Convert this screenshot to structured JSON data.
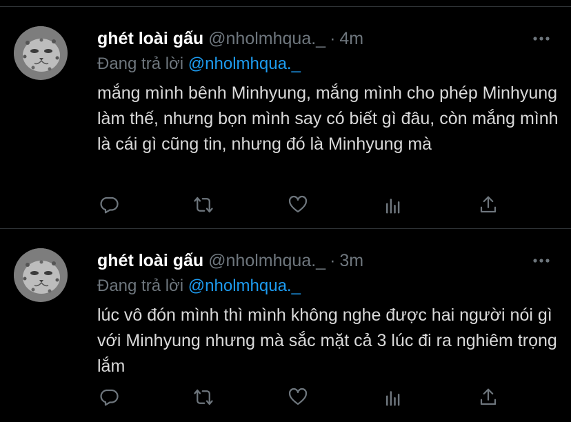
{
  "tweets": [
    {
      "author_name": "ghét loài gấu",
      "handle": "@nholmhqua._",
      "separator": "·",
      "time": "4m",
      "replying_prefix": "Đang trả lời",
      "replying_mention": "@nholmhqua._",
      "text": "mắng mình bênh Minhyung, mắng mình cho phép Minhyung làm thế, nhưng bọn mình say có biết gì đâu, còn mắng mình là cái gì cũng tin, nhưng đó là Minhyung mà"
    },
    {
      "author_name": "ghét loài gấu",
      "handle": "@nholmhqua._",
      "separator": "·",
      "time": "3m",
      "replying_prefix": "Đang trả lời",
      "replying_mention": "@nholmhqua._",
      "text": "lúc vô đón mình thì mình không nghe được hai người nói gì với Minhyung nhưng mà sắc mặt cả 3 lúc đi ra nghiêm trọng lắm"
    }
  ],
  "icons": {
    "more": "more-options-icon",
    "reply": "reply-icon",
    "retweet": "retweet-icon",
    "like": "heart-icon",
    "stats": "stats-icon",
    "share": "share-icon"
  },
  "colors": {
    "background": "#000000",
    "name": "#ffffff",
    "text": "#d9d9d9",
    "muted": "#6e767d",
    "mention": "#1d9bf0",
    "divider": "#2f3336"
  }
}
